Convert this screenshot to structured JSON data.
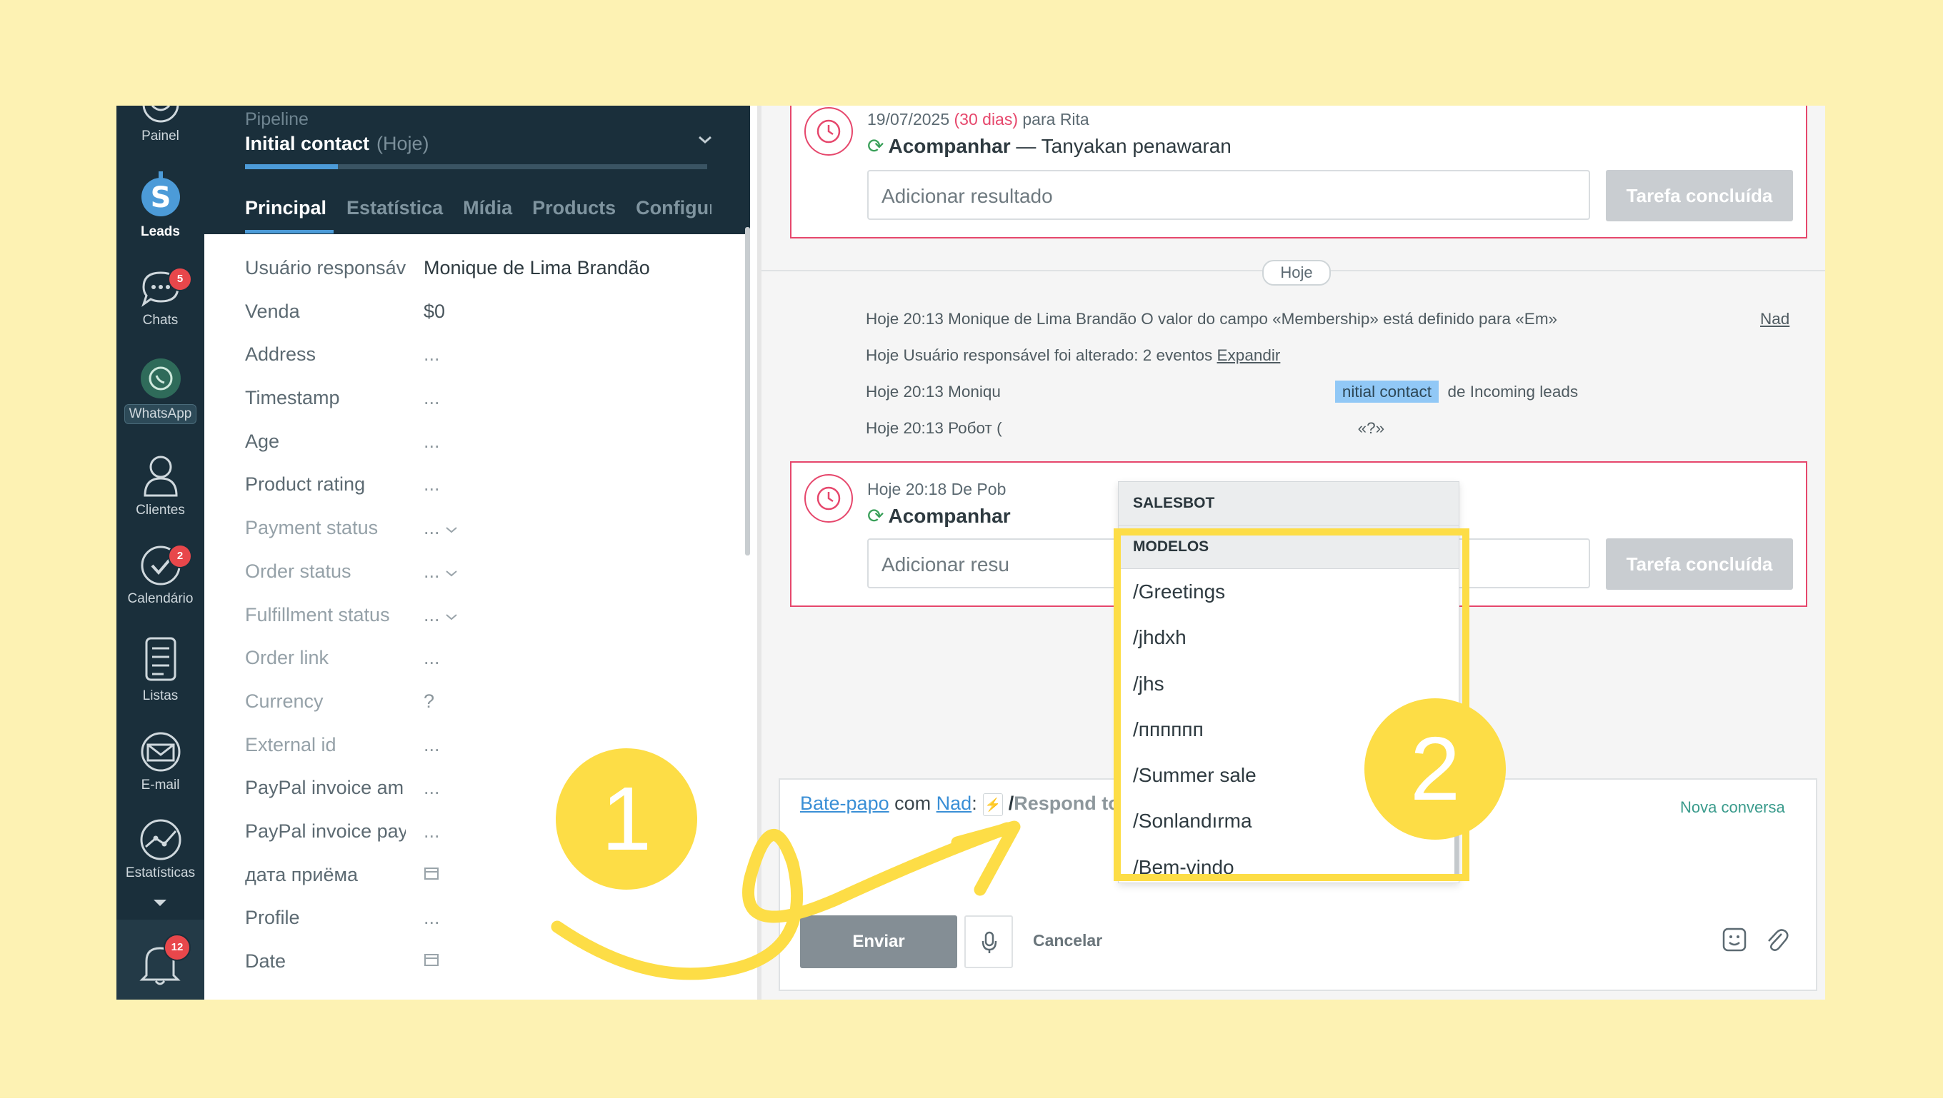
{
  "nav": {
    "items": [
      {
        "label": "Painel"
      },
      {
        "label": "Leads"
      },
      {
        "label": "Chats",
        "badge": "5"
      },
      {
        "label": "WhatsApp"
      },
      {
        "label": "Clientes"
      },
      {
        "label": "Calendário",
        "badge": "2"
      },
      {
        "label": "Listas"
      },
      {
        "label": "E-mail"
      },
      {
        "label": "Estatísticas"
      }
    ],
    "notifications_badge": "12"
  },
  "lead": {
    "pipeline_label": "Pipeline",
    "stage": "Initial contact",
    "stage_date": "(Hoje)",
    "tabs": [
      "Principal",
      "Estatística",
      "Mídia",
      "Products",
      "Configuraç"
    ],
    "fields": [
      {
        "key": "Usuário responsáv",
        "value": "Monique de Lima Brandão"
      },
      {
        "key": "Venda",
        "value": "$0"
      },
      {
        "key": "Address",
        "value": "..."
      },
      {
        "key": "Timestamp",
        "value": "..."
      },
      {
        "key": "Age",
        "value": "..."
      },
      {
        "key": "Product rating",
        "value": "..."
      },
      {
        "key": "Payment status",
        "value": "..."
      },
      {
        "key": "Order status",
        "value": "..."
      },
      {
        "key": "Fulfillment status",
        "value": "..."
      },
      {
        "key": "Order link",
        "value": "..."
      },
      {
        "key": "Currency",
        "value": "?"
      },
      {
        "key": "External id",
        "value": "..."
      },
      {
        "key": "PayPal invoice am",
        "value": "..."
      },
      {
        "key": "PayPal invoice pay",
        "value": "..."
      },
      {
        "key": "дата приёма",
        "value": ""
      },
      {
        "key": "Profile",
        "value": "..."
      },
      {
        "key": "Date",
        "value": ""
      }
    ]
  },
  "feed": {
    "task1": {
      "date": "19/07/2025",
      "days": "(30 dias)",
      "for": "para Rita",
      "type": "Acompanhar",
      "text": "— Tanyakan penawaran",
      "result_placeholder": "Adicionar resultado",
      "done_label": "Tarefa concluída"
    },
    "day_separator": "Hoje",
    "events": [
      {
        "text": "Hoje 20:13 Monique de Lima Brandão O valor do campo «Membership» está definido para «Em»",
        "right": "Nad"
      },
      {
        "text": "Hoje Usuário responsável foi alterado: 2 eventos",
        "link": "Expandir"
      },
      {
        "text": "Hoje 20:13 Moniqu",
        "tag": "nitial contact",
        "suffix": "de Incoming leads"
      },
      {
        "text": "Hoje 20:13 Робот (",
        "suffix": "«?»"
      }
    ],
    "task2": {
      "meta": "Hoje 20:18 De Pob",
      "type": "Acompanhar",
      "result_placeholder": "Adicionar resu",
      "done_label": "Tarefa concluída"
    }
  },
  "dropdown": {
    "section1": "SALESBOT",
    "section2": "MODELOS",
    "items": [
      "/Greetings",
      "/jhdxh",
      "/jhs",
      "/пппппп",
      "/Summer sale",
      "/Sonlandırma",
      "/Bem-vindo"
    ]
  },
  "composer": {
    "chat_link": "Bate-papo",
    "with": "com",
    "contact": "Nad",
    "colon": ":",
    "slash": "/",
    "placeholder": "Respond to incoming conversations",
    "new_conversation": "Nova conversa",
    "send_label": "Enviar",
    "cancel_label": "Cancelar"
  },
  "annotations": {
    "step1": "1",
    "step2": "2"
  },
  "colors": {
    "background": "#fdf2b3",
    "annotation": "#fddd46",
    "nav": "#1a2f3b",
    "task_border": "#e6476c",
    "link": "#3a8fd6"
  }
}
